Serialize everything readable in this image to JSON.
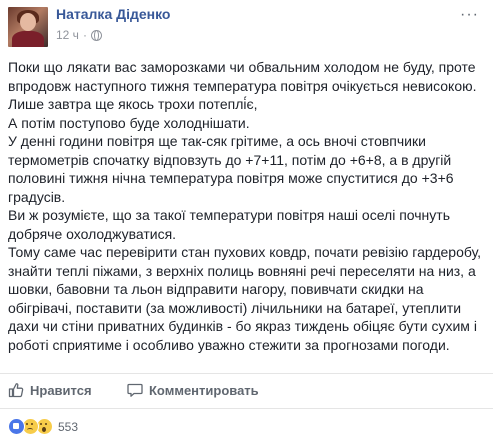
{
  "post": {
    "author": "Наталка Діденко",
    "timestamp": "12 ч",
    "separator": "·",
    "more_label": "···",
    "paragraphs": [
      "Поки що лякати вас заморозками чи обвальним холодом не буду, проте впродовж наступного тижня температура повітря очікується невисокою.",
      "Лише завтра ще якось трохи потеплі́є,",
      "А потім поступово буде холоднішати.",
      "У денні години повітря ще так-сяк грітиме, а ось вночі стовпчики термометрів спочатку відповзуть до +7+11, потім до +6+8, а в другій половині тижня нічна температура повітря може спуститися до +3+6 градусів.",
      "Ви ж розумієте, що за такої температури повітря наші оселі почнуть добряче охолоджуватися.",
      "Тому саме час перевірити стан пухових ковдр, почати ревізію гардеробу, знайти теплі піжами, з верхніх полиць вовняні речі переселяти на низ, а шовки, бавовни та льон відправити нагору, повивчати скидки на обігрівачі, поставити (за можливості) лічильники на батареї, утеплити дахи чи стіни приватних будинків - бо якраз тиждень обіцяє бути сухим і роботі сприятиме і особливо уважно стежити за прогнозами погоди."
    ]
  },
  "actions": {
    "like_label": "Нравится",
    "comment_label": "Комментировать"
  },
  "reactions": {
    "types": [
      "like",
      "sad",
      "wow"
    ],
    "count": "553"
  }
}
